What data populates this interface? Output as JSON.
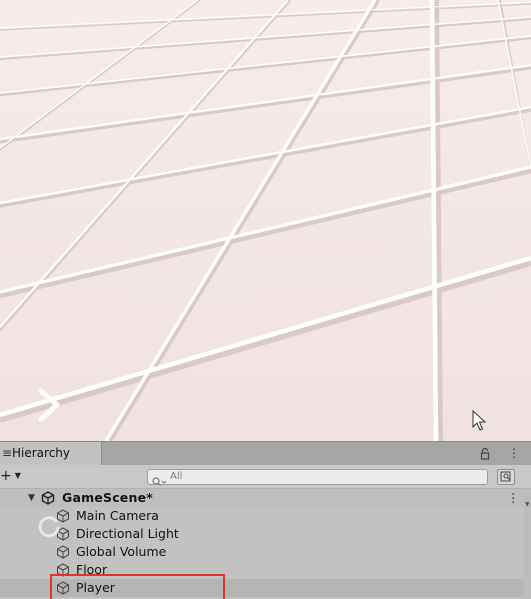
{
  "hierarchy": {
    "tab_label": "Hierarchy",
    "search_placeholder": "All",
    "scene_name": "GameScene*",
    "objects": [
      {
        "name": "Main Camera"
      },
      {
        "name": "Directional Light"
      },
      {
        "name": "Global Volume"
      },
      {
        "name": "Floor"
      },
      {
        "name": "Player",
        "highlighted": true
      }
    ]
  },
  "icons": {
    "tab_menu": "hamburger-menu-icon",
    "lock": "lock-icon",
    "more": "kebab-icon",
    "add": "plus-icon",
    "search": "search-icon",
    "filter": "filter-icon",
    "scene": "unity-logo-icon",
    "object": "cube-icon",
    "chevron": "chevron-right-icon",
    "cursor": "mouse-pointer-icon"
  },
  "colors": {
    "floor": "#f3e6e4",
    "grid_line": "#ffffff",
    "grid_shadow": "#d9c8c6",
    "panel_bg": "#c2c2c2",
    "highlight_border": "#e0332c"
  }
}
